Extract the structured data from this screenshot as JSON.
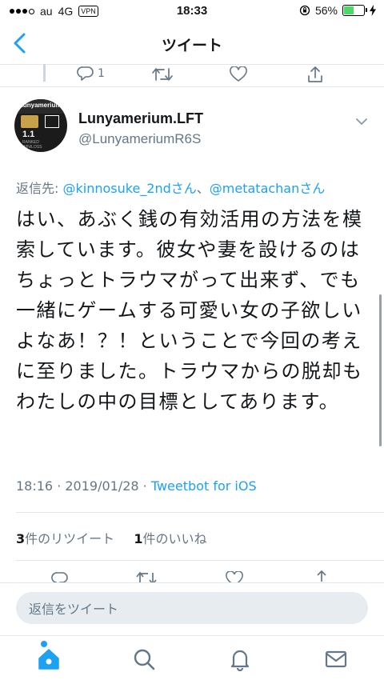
{
  "status_bar": {
    "carrier": "au",
    "network": "4G",
    "vpn": "VPN",
    "time": "18:33",
    "battery": "56%",
    "battery_level": 0.56
  },
  "nav": {
    "title": "ツイート"
  },
  "prev_tweet_actions": {
    "reply_count": "1"
  },
  "tweet": {
    "display_name": "Lunyamerium.LFT",
    "handle": "@LunyameriumR6S",
    "avatar_text": {
      "top": "Lunyamerium",
      "rank": "1.1",
      "sub1": "RANKED",
      "sub2": "WIN/LOSS"
    },
    "reply_prefix": "返信先: ",
    "reply_mention1": "@kinnosuke_2ndさん",
    "reply_sep": "、",
    "reply_mention2": "@metatachanさん",
    "text": "はい、あぶく銭の有効活用の方法を模索しています。彼女や妻を設けるのはちょっとトラウマがって出来ず、でも一緒にゲームする可愛い女の子欲しいよなあ！？！ということで今回の考えに至りました。トラウマからの脱却もわたしの中の目標としてあります。",
    "timestamp": "18:16 · 2019/01/28 · ",
    "client": "Tweetbot for iOS",
    "retweet_count": "3",
    "retweet_label": "件のリツイート",
    "like_count": "1",
    "like_label": "件のいいね"
  },
  "reply_box": {
    "placeholder": "返信をツイート"
  },
  "colors": {
    "accent": "#1da1f2",
    "secondary_text": "#657786",
    "divider": "#e1e8ed"
  }
}
